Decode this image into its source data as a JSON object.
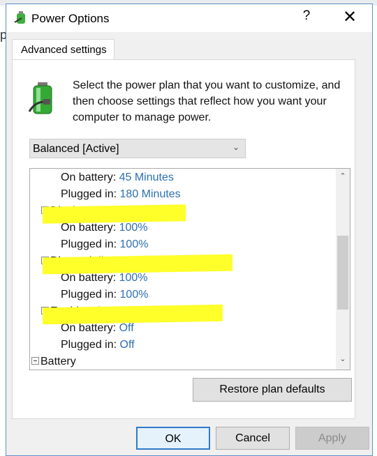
{
  "window": {
    "title": "Power Options",
    "help_label": "?",
    "close_label": "✕"
  },
  "background": {
    "left_letter": "p"
  },
  "tab": {
    "label": "Advanced settings"
  },
  "description": "Select the power plan that you want to customize, and then choose settings that reflect how you want your computer to manage power.",
  "plan_select": {
    "value": "Balanced [Active]"
  },
  "tree": [
    {
      "label": "On battery:",
      "value": "45 Minutes",
      "level": 2
    },
    {
      "label": "Plugged in:",
      "value": "180 Minutes",
      "level": 2
    },
    {
      "label": "Display brightness",
      "level": 1,
      "highlighted": true
    },
    {
      "label": "On battery:",
      "value": "100%",
      "level": 2
    },
    {
      "label": "Plugged in:",
      "value": "100%",
      "level": 2
    },
    {
      "label": "Dimmed display brightness",
      "level": 1,
      "highlighted": true
    },
    {
      "label": "On battery:",
      "value": "100%",
      "level": 2
    },
    {
      "label": "Plugged in:",
      "value": "100%",
      "level": 2
    },
    {
      "label": "Enable adaptive brightness",
      "level": 1,
      "highlighted": true
    },
    {
      "label": "On battery:",
      "value": "Off",
      "level": 2
    },
    {
      "label": "Plugged in:",
      "value": "Off",
      "level": 2
    },
    {
      "label": "Battery",
      "level": 0
    }
  ],
  "buttons": {
    "restore": "Restore plan defaults",
    "ok": "OK",
    "cancel": "Cancel",
    "apply": "Apply"
  },
  "colors": {
    "value": "#2e6fb0",
    "highlight": "#ffff2a",
    "accent": "#2f7bc8"
  }
}
